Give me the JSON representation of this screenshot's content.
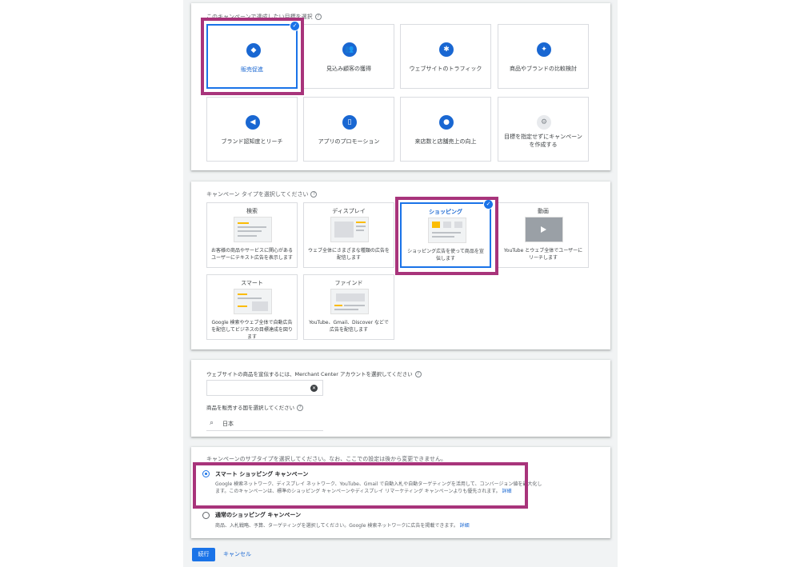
{
  "goals": {
    "title": "このキャンペーンで達成したい目標を選択",
    "items": [
      {
        "label": "販売促進",
        "icon": "tag-icon",
        "glyph": "◆"
      },
      {
        "label": "見込み顧客の獲得",
        "icon": "people-icon",
        "glyph": "👥"
      },
      {
        "label": "ウェブサイトのトラフィック",
        "icon": "cursor-click-icon",
        "glyph": "✱"
      },
      {
        "label": "商品やブランドの比較検討",
        "icon": "sparkle-icon",
        "glyph": "✦"
      },
      {
        "label": "ブランド認知度とリーチ",
        "icon": "megaphone-icon",
        "glyph": "◀"
      },
      {
        "label": "アプリのプロモーション",
        "icon": "phone-icon",
        "glyph": "▯"
      },
      {
        "label": "来店数と店舗売上の向上",
        "icon": "location-pin-icon",
        "glyph": "●"
      },
      {
        "label": "目標を指定せずにキャンペーンを作成する",
        "icon": "gear-icon",
        "glyph": "⚙"
      }
    ]
  },
  "campaign_types": {
    "title": "キャンペーン タイプを選択してください",
    "items": [
      {
        "title": "検索",
        "desc": "お客様の商品やサービスに関心があるユーザーにテキスト広告を表示します"
      },
      {
        "title": "ディスプレイ",
        "desc": "ウェブ全体にさまざまな種類の広告を配信します"
      },
      {
        "title": "ショッピング",
        "desc": "ショッピング広告を使って商品を宣伝します"
      },
      {
        "title": "動画",
        "desc": "YouTube とウェブ全体でユーザーにリーチします"
      },
      {
        "title": "スマート",
        "desc": "Google 検索やウェブ全体で自動広告を配信してビジネスの目標達成を図ります"
      },
      {
        "title": "ファインド",
        "desc": "YouTube、Gmail、Discover などで広告を配信します"
      }
    ]
  },
  "merchant": {
    "label": "ウェブサイトの商品を宣伝するには、Merchant Center アカウントを選択してください",
    "country_label": "商品を販売する国を選択してください",
    "country_value": "日本"
  },
  "subtype": {
    "title": "キャンペーンのサブタイプを選択してください。なお、ここでの設定は後から変更できません。",
    "options": [
      {
        "title": "スマート ショッピング キャンペーン",
        "desc": "Google 検索ネットワーク、ディスプレイ ネットワーク、YouTube、Gmail で自動入札や自動ターゲティングを活用して、コンバージョン値を最大化します。このキャンペーンは、標準のショッピング キャンペーンやディスプレイ リマーケティング キャンペーンよりも優先されます。",
        "link": "詳細"
      },
      {
        "title": "通常のショッピング キャンペーン",
        "desc": "商品、入札戦略、予算、ターゲティングを選択してください。Google 検索ネットワークに広告を掲載できます。",
        "link": "詳細"
      }
    ]
  },
  "actions": {
    "continue": "続行",
    "cancel": "キャンセル"
  },
  "glyphs": {
    "check": "✓",
    "help": "?",
    "clear": "✕",
    "search": "⌕"
  },
  "colors": {
    "accent": "#1a73e8",
    "highlight": "#a8347b",
    "background": "#f1f3f4"
  }
}
